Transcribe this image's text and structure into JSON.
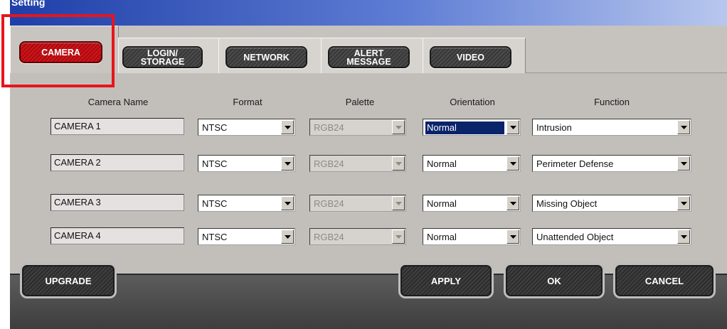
{
  "window": {
    "title": "Setting"
  },
  "tabs": [
    {
      "label": "CAMERA",
      "active": true
    },
    {
      "label": "LOGIN/\nSTORAGE",
      "active": false
    },
    {
      "label": "NETWORK",
      "active": false
    },
    {
      "label": "ALERT\nMESSAGE",
      "active": false
    },
    {
      "label": "VIDEO",
      "active": false
    }
  ],
  "columns": {
    "camera_name": "Camera Name",
    "format": "Format",
    "palette": "Palette",
    "orientation": "Orientation",
    "function": "Function"
  },
  "rows": [
    {
      "name": "CAMERA 1",
      "format": "NTSC",
      "palette": "RGB24",
      "orientation": "Normal",
      "function": "Intrusion"
    },
    {
      "name": "CAMERA 2",
      "format": "NTSC",
      "palette": "RGB24",
      "orientation": "Normal",
      "function": "Perimeter Defense"
    },
    {
      "name": "CAMERA 3",
      "format": "NTSC",
      "palette": "RGB24",
      "orientation": "Normal",
      "function": "Missing Object"
    },
    {
      "name": "CAMERA 4",
      "format": "NTSC",
      "palette": "RGB24",
      "orientation": "Normal",
      "function": "Unattended Object"
    }
  ],
  "buttons": {
    "upgrade": "UPGRADE",
    "apply": "APPLY",
    "ok": "OK",
    "cancel": "CANCEL"
  },
  "colors": {
    "accent_red": "#d0141a",
    "highlight_red": "#e8141c",
    "selection_blue": "#0a246a"
  }
}
